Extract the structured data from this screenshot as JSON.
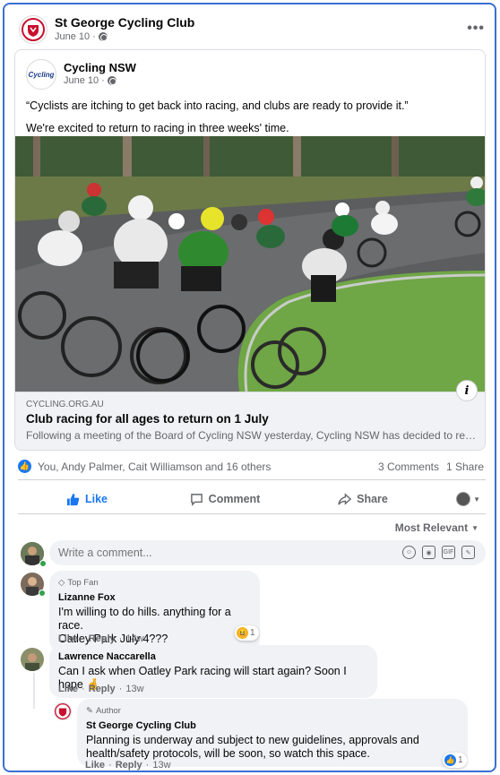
{
  "post": {
    "page_name": "St George Cycling Club",
    "date": "June 10",
    "date_sep": "·",
    "more_icon": "more-horizontal-icon"
  },
  "shared": {
    "page_name": "Cycling NSW",
    "logo_text": "Cycling",
    "date": "June 10",
    "date_sep": "·",
    "text_1": "“Cyclists are itching to get back into racing, and clubs are ready to provide it.”",
    "text_2": "We're excited to return to racing in three weeks' time.",
    "link": {
      "domain": "CYCLING.ORG.AU",
      "title": "Club racing for all ages to return on 1 July",
      "description": "Following a meeting of the Board of Cycling NSW yesterday, Cycling NSW has decided to reco..."
    }
  },
  "reactions": {
    "summary": "You, Andy Palmer, Cait Williamson and 16 others",
    "comments": "3 Comments",
    "shares": "1 Share"
  },
  "actions": {
    "like": "Like",
    "comment": "Comment",
    "share": "Share"
  },
  "sort": {
    "label": "Most Relevant"
  },
  "composer": {
    "placeholder": "Write a comment..."
  },
  "comments": [
    {
      "badge": "Top Fan",
      "author": "Lizanne Fox",
      "line_1": "I'm willing to do hills. anything for a race.",
      "line_2": "Oatley Park July 4???",
      "like": "Like",
      "reply": "Reply",
      "time": "14w",
      "reaction_count": "1",
      "sep": "·"
    },
    {
      "author": "Lawrence Naccarella",
      "line_1": "Can I ask when Oatley Park racing will start again? Soon I hope 🤞",
      "like": "Like",
      "reply": "Reply",
      "time": "13w",
      "sep": "·"
    },
    {
      "badge": "Author",
      "author": "St George Cycling Club",
      "line_1": "Planning is underway and subject to new guidelines, approvals and",
      "line_2": "health/safety protocols, will be soon, so watch this space.",
      "like": "Like",
      "reply": "Reply",
      "time": "13w",
      "reaction_count": "1",
      "sep": "·"
    }
  ],
  "colors": {
    "accent": "#1877f2",
    "frame": "#3b6fd3",
    "muted": "#65676b",
    "bubble": "#f0f2f5",
    "club_red": "#c8102e"
  }
}
